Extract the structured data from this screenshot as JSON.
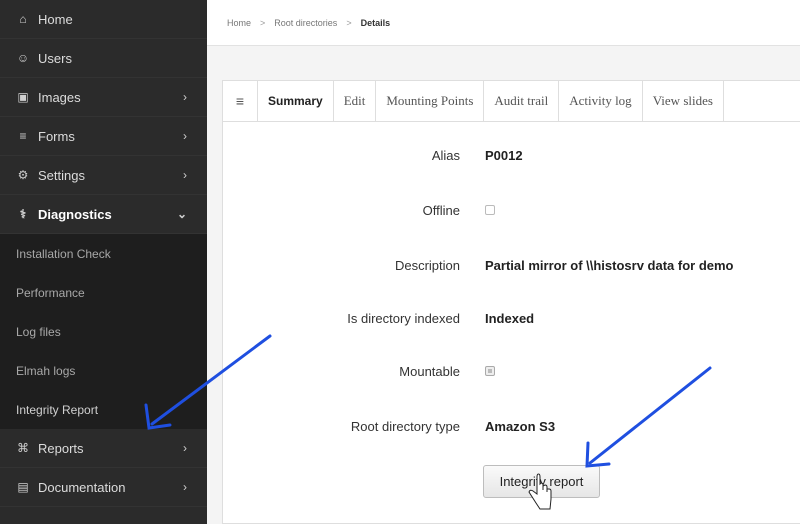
{
  "sidebar": {
    "items": [
      {
        "label": "Home",
        "icon": "home-icon",
        "glyph": "⌂",
        "chevron": false
      },
      {
        "label": "Users",
        "icon": "users-icon",
        "glyph": "☰",
        "chevron": false
      },
      {
        "label": "Images",
        "icon": "image-icon",
        "glyph": "▣",
        "chevron": true
      },
      {
        "label": "Forms",
        "icon": "forms-icon",
        "glyph": "≡",
        "chevron": true
      },
      {
        "label": "Settings",
        "icon": "gears-icon",
        "glyph": "⚙",
        "chevron": true
      },
      {
        "label": "Diagnostics",
        "icon": "stethoscope-icon",
        "glyph": "⚕",
        "chevron": true,
        "expanded": true
      }
    ],
    "diagnostics_sub": [
      "Installation Check",
      "Performance",
      "Log files",
      "Elmah logs",
      "Integrity Report"
    ],
    "bottom_items": [
      {
        "label": "Reports",
        "icon": "reports-icon",
        "glyph": "⌘"
      },
      {
        "label": "Documentation",
        "icon": "documentation-icon",
        "glyph": "▤"
      }
    ]
  },
  "breadcrumb": {
    "home": "Home",
    "root": "Root directories",
    "current": "Details"
  },
  "tabs": [
    "Summary",
    "Edit",
    "Mounting Points",
    "Audit trail",
    "Activity log",
    "View slides"
  ],
  "details": {
    "alias_label": "Alias",
    "alias_value": "P0012",
    "offline_label": "Offline",
    "offline_checked": false,
    "description_label": "Description",
    "description_value": "Partial mirror of \\\\histosrv data for demo",
    "indexed_label": "Is directory indexed",
    "indexed_value": "Indexed",
    "mountable_label": "Mountable",
    "mountable_checked": true,
    "type_label": "Root directory type",
    "type_value": "Amazon S3"
  },
  "button": {
    "integrity_report": "Integrity report"
  },
  "colors": {
    "sidebar_bg": "#2b2b2b",
    "submenu_bg": "#1e1e1e",
    "arrow": "#1f4fe0"
  }
}
